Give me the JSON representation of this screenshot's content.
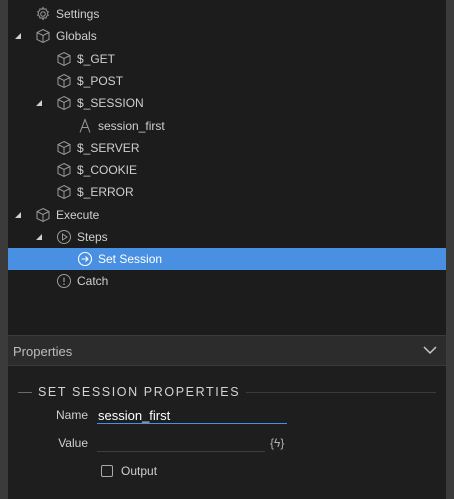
{
  "tree": {
    "settings": "Settings",
    "globals": "Globals",
    "get": "$_GET",
    "post": "$_POST",
    "session": "$_SESSION",
    "session_first": "session_first",
    "server": "$_SERVER",
    "cookie": "$_COOKIE",
    "error": "$_ERROR",
    "execute": "Execute",
    "steps": "Steps",
    "set_session": "Set Session",
    "catch": "Catch"
  },
  "panel": {
    "header": "Properties",
    "section_title": "SET SESSION PROPERTIES",
    "name_label": "Name",
    "name_value": "session_first",
    "value_label": "Value",
    "value_value": "",
    "output_label": "Output",
    "output_checked": false,
    "dynamic_icon_text": "{ϟ}"
  },
  "colors": {
    "accent": "#4a90e2",
    "frame": "#3b3b3b"
  }
}
